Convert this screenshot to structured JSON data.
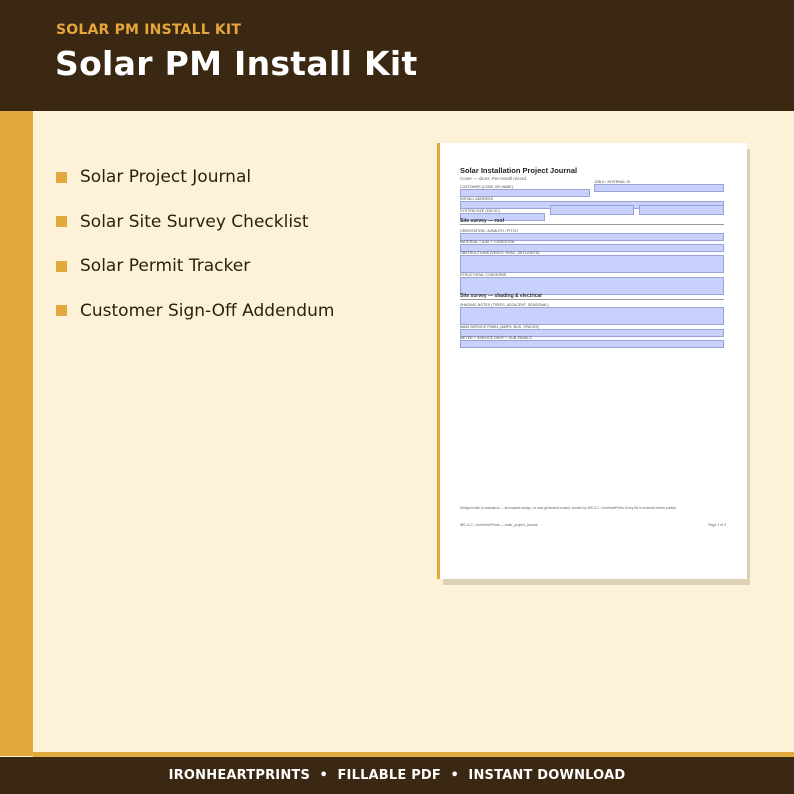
{
  "header": {
    "eyebrow": "SOLAR PM INSTALL KIT",
    "title": "Solar PM Install Kit"
  },
  "bullets": [
    {
      "label": "Solar Project Journal"
    },
    {
      "label": "Solar Site Survey Checklist"
    },
    {
      "label": "Solar Permit Tracker"
    },
    {
      "label": "Customer Sign-Off Addendum"
    }
  ],
  "preview": {
    "title": "Solar Installation Project Journal",
    "subtitle": "Cover — dices. Per-install record.",
    "labels": {
      "job_id": "JOB # / INTERNAL ID",
      "customer": "CUSTOMER (CODE OR NAME)",
      "address": "INSTALL ADDRESS",
      "system_size": "SYSTEM SIZE (KW DC)",
      "orientation": "ORIENTATION / AZIMUTH / PITCH",
      "material": "MATERIAL + AGE + CONDITION",
      "obstructions": "OBSTRUCTIONS (VENTS, HVAC, SKYLIGHTS)",
      "structural": "STRUCTURAL CONCERNS",
      "shading": "SHADING NOTES (TREES, ADJACENT, SEASONAL)",
      "main_panel": "MAIN SERVICE PANEL (AMPS, BUS, SPACES)",
      "meter": "METER + SERVICE DROP + SUB-PANELS"
    },
    "sections": {
      "roof": "Site survey — roof",
      "electrical": "Site survey — shading & electrical"
    },
    "note": "Designed with AI assistance — at-template design, no auto-generated content. curated by IBS LLC / IronHeartPrints. Every file is reviewed before publish.",
    "footer_left": "IBS LLC / IronHeartPrints — solar_project_journal",
    "footer_right": "Page 1 of 3"
  },
  "footer": {
    "text": "IRONHEARTPRINTS  •  FILLABLE PDF  •  INSTANT DOWNLOAD"
  },
  "colors": {
    "header_bg": "#3b2812",
    "accent": "#e2aa3c",
    "page_bg": "#fdf1d8",
    "field_fill": "#c8d1fb"
  }
}
